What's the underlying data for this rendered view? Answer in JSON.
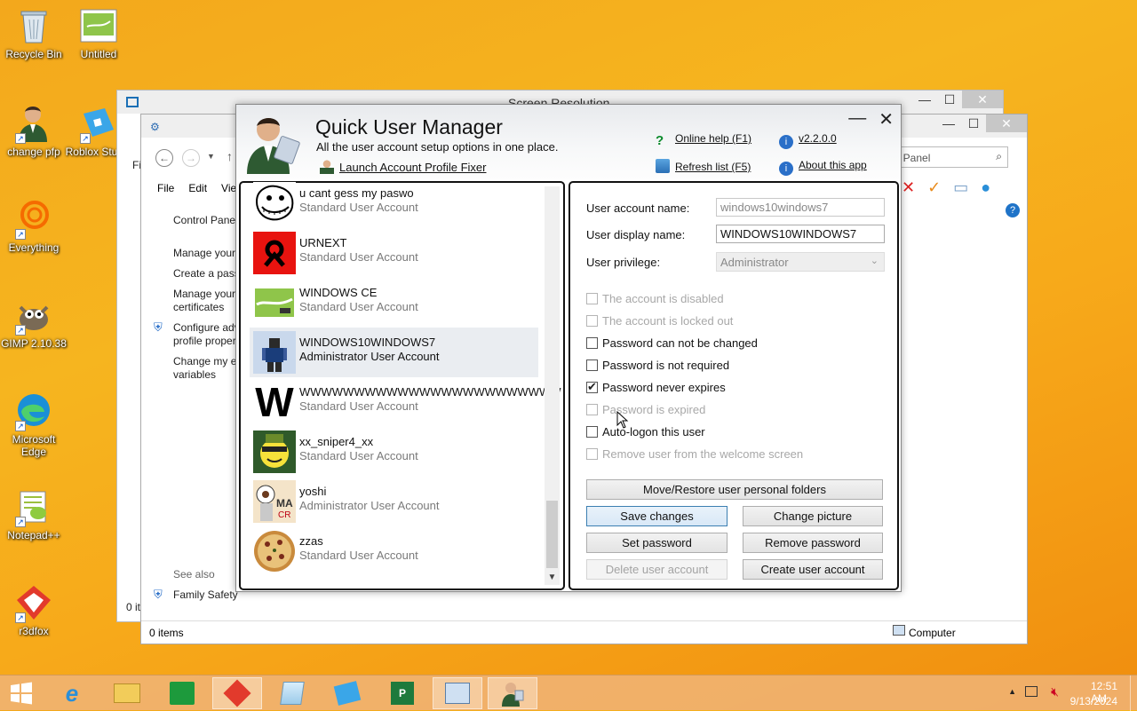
{
  "desktop": {
    "icons": [
      {
        "label": "Recycle Bin",
        "icon": "recycle-bin-icon"
      },
      {
        "label": "Untitled",
        "icon": "image-file-icon"
      },
      {
        "label": "change pfp",
        "icon": "user-icon"
      },
      {
        "label": "Roblox Studio",
        "icon": "roblox-studio-icon"
      },
      {
        "label": "Everything",
        "icon": "everything-search-icon"
      },
      {
        "label": "GIMP 2.10.38",
        "icon": "gimp-icon"
      },
      {
        "label": "Microsoft Edge",
        "icon": "edge-icon"
      },
      {
        "label": "Notepad++",
        "icon": "notepadpp-icon"
      },
      {
        "label": "r3dfox",
        "icon": "r3dfox-icon"
      }
    ]
  },
  "screen_resolution_window": {
    "title": "Screen Resolution"
  },
  "explorer": {
    "menu": [
      "File",
      "Edit",
      "View"
    ],
    "search_placeholder": "ol Panel",
    "sidebar": {
      "home": "Control Panel",
      "links": [
        "Manage your",
        "Create a pass",
        "Manage your certificates",
        "Configure adv profile proper",
        "Change my e variables"
      ],
      "see_also": "See also",
      "family_safety": "Family Safety"
    },
    "status_items": "0 items",
    "status_items_left": "0 it",
    "status_location": "Computer",
    "cut_label": "Fi"
  },
  "qum": {
    "title": "Quick User Manager",
    "subtitle": "All the user account setup options in one place.",
    "launch_fixer": "Launch Account Profile Fixer",
    "online_help": "Online help (F1)",
    "refresh_list": "Refresh list (F5)",
    "version": "v2.2.0.0",
    "about": "About this app",
    "users": [
      {
        "name": "u cant gess my paswo",
        "type": "Standard User Account",
        "avatar": "trollface"
      },
      {
        "name": "URNEXT",
        "type": "Standard User Account",
        "avatar": "red-logo"
      },
      {
        "name": "WINDOWS CE",
        "type": "Standard User Account",
        "avatar": "green-card"
      },
      {
        "name": "WINDOWS10WINDOWS7",
        "type": "Administrator User Account",
        "avatar": "roblox-character"
      },
      {
        "name": "WWWWWWWWWWWWWWWWWWWWWWWW",
        "type": "Standard User Account",
        "avatar": "letter-w"
      },
      {
        "name": "xx_sniper4_xx",
        "type": "Standard User Account",
        "avatar": "smiley"
      },
      {
        "name": "yoshi",
        "type": "Administrator User Account",
        "avatar": "cartoon"
      },
      {
        "name": "zzas",
        "type": "Standard User Account",
        "avatar": "pizza"
      }
    ],
    "form": {
      "account_name_label": "User account name:",
      "account_name_value": "windows10windows7",
      "display_name_label": "User display name:",
      "display_name_value": "WINDOWS10WINDOWS7",
      "privilege_label": "User privilege:",
      "privilege_value": "Administrator"
    },
    "checkboxes": [
      {
        "label": "The account is disabled",
        "checked": false,
        "disabled": true
      },
      {
        "label": "The account is locked out",
        "checked": false,
        "disabled": true
      },
      {
        "label": "Password can not be changed",
        "checked": false,
        "disabled": false
      },
      {
        "label": "Password is not required",
        "checked": false,
        "disabled": false
      },
      {
        "label": "Password never expires",
        "checked": true,
        "disabled": false
      },
      {
        "label": "Password is expired",
        "checked": false,
        "disabled": true
      },
      {
        "label": "Auto-logon this user",
        "checked": false,
        "disabled": false
      },
      {
        "label": "Remove user from the welcome screen",
        "checked": false,
        "disabled": true
      }
    ],
    "buttons": {
      "move_restore": "Move/Restore user personal folders",
      "save": "Save changes",
      "change_picture": "Change picture",
      "set_password": "Set password",
      "remove_password": "Remove password",
      "delete_user": "Delete user account",
      "create_user": "Create user account"
    }
  },
  "taskbar": {
    "clock_time": "12:51 AM",
    "clock_date": "9/13/2024"
  },
  "colors": {
    "accent_green": "#0a8a2a",
    "desktop_orange": "#f6b51f"
  }
}
